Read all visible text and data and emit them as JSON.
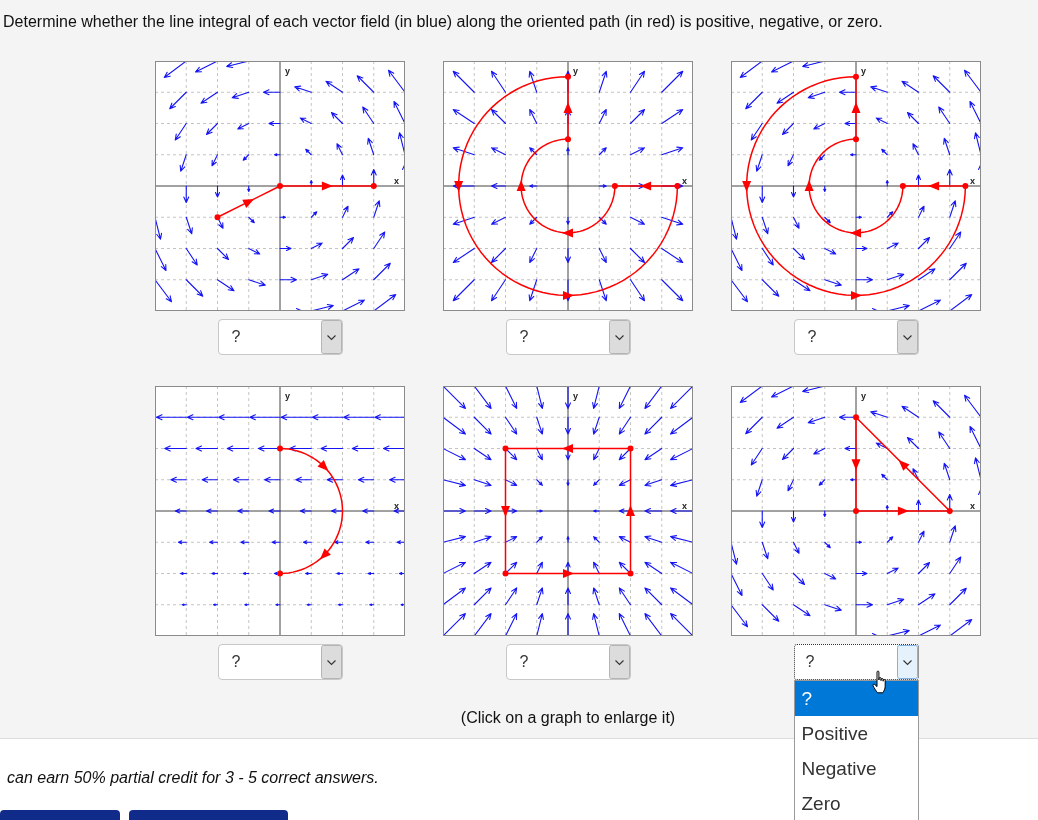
{
  "instructions": "Determine whether the line integral of each vector field (in blue) along the oriented path (in red) is positive, negative, or zero.",
  "graphs": [
    {
      "field": {
        "kind": "rotation"
      },
      "path": {
        "kind": "polyline"
      },
      "x_label": "x",
      "y_label": "y",
      "answer": {
        "value": "?",
        "expanded": false,
        "hovered": false
      }
    },
    {
      "field": {
        "kind": "source"
      },
      "path": {
        "kind": "spiral"
      },
      "x_label": "x",
      "y_label": "y",
      "answer": {
        "value": "?",
        "expanded": false,
        "hovered": false
      }
    },
    {
      "field": {
        "kind": "rotation"
      },
      "path": {
        "kind": "spiral"
      },
      "x_label": "x",
      "y_label": "y",
      "answer": {
        "value": "?",
        "expanded": false,
        "hovered": false
      }
    },
    {
      "field": {
        "kind": "leftward"
      },
      "path": {
        "kind": "semicircle"
      },
      "x_label": "x",
      "y_label": "y",
      "answer": {
        "value": "?",
        "expanded": false,
        "hovered": false
      }
    },
    {
      "field": {
        "kind": "sink"
      },
      "path": {
        "kind": "square"
      },
      "x_label": "x",
      "y_label": "y",
      "answer": {
        "value": "?",
        "expanded": false,
        "hovered": false
      }
    },
    {
      "field": {
        "kind": "rotation"
      },
      "path": {
        "kind": "triangle"
      },
      "x_label": "x",
      "y_label": "y",
      "answer": {
        "value": "?",
        "expanded": true,
        "hovered": true,
        "options": [
          {
            "label": "?",
            "selected": true
          },
          {
            "label": "Positive",
            "selected": false
          },
          {
            "label": "Negative",
            "selected": false
          },
          {
            "label": "Zero",
            "selected": false
          }
        ]
      }
    }
  ],
  "note": "(Click on a graph to enlarge it)",
  "credit_note": "can earn 50% partial credit for 3 - 5 correct answers.",
  "buttons": [
    {
      "kind": "primary"
    },
    {
      "kind": "primary"
    }
  ]
}
